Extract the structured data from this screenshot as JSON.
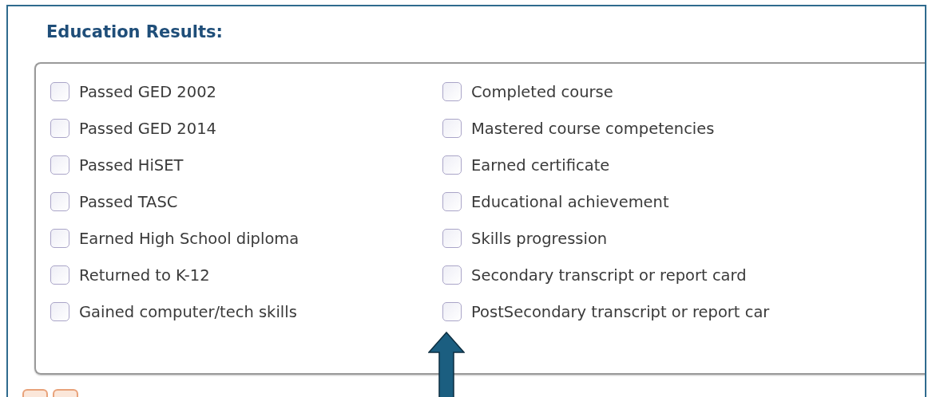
{
  "section": {
    "title": "Education Results:"
  },
  "columns": [
    {
      "items": [
        {
          "label": "Passed GED 2002",
          "checked": false
        },
        {
          "label": "Passed GED 2014",
          "checked": false
        },
        {
          "label": "Passed HiSET",
          "checked": false
        },
        {
          "label": "Passed TASC",
          "checked": false
        },
        {
          "label": "Earned High School diploma",
          "checked": false
        },
        {
          "label": "Returned to K-12",
          "checked": false
        },
        {
          "label": "Gained computer/tech skills",
          "checked": false
        }
      ]
    },
    {
      "items": [
        {
          "label": "Completed course",
          "checked": false
        },
        {
          "label": "Mastered course competencies",
          "checked": false
        },
        {
          "label": "Earned certificate",
          "checked": false
        },
        {
          "label": "Educational achievement",
          "checked": false
        },
        {
          "label": "Skills progression",
          "checked": false
        },
        {
          "label": "Secondary transcript or report card",
          "checked": false
        },
        {
          "label": "PostSecondary transcript or report car",
          "checked": false
        }
      ]
    }
  ]
}
